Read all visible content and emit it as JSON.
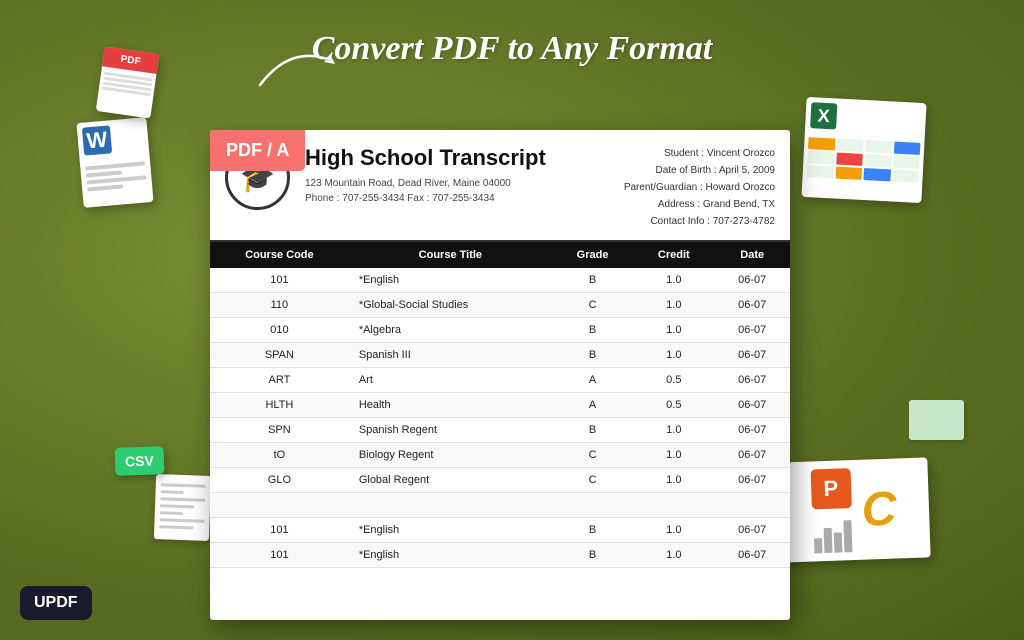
{
  "page": {
    "heading": "Convert PDF to Any Format",
    "background_color": "#6b7c2d"
  },
  "badges": {
    "pdf_a": "PDF / A",
    "csv": "CSV",
    "updf": "UPDF"
  },
  "transcript": {
    "title": "High School Transcript",
    "address_line1": "123 Mountain Road, Dead River, Maine 04000",
    "address_line2": "Phone : 707-255-3434    Fax : 707-255-3434",
    "student_label": "Student :",
    "student_name": "Vincent Orozco",
    "dob_label": "Date of Birth :",
    "dob": "April 5,  2009",
    "parent_label": "Parent/Guardian :",
    "parent": "Howard Orozco",
    "address_label": "Address :",
    "address": "Grand Bend, TX",
    "contact_label": "Contact Info :",
    "contact": "707-273-4782",
    "table": {
      "headers": [
        "Course Code",
        "Course Title",
        "Grade",
        "Credit",
        "Date"
      ],
      "rows": [
        {
          "code": "101",
          "title": "*English",
          "grade": "B",
          "credit": "1.0",
          "date": "06-07"
        },
        {
          "code": "110",
          "title": "*Global-Social Studies",
          "grade": "C",
          "credit": "1.0",
          "date": "06-07"
        },
        {
          "code": "010",
          "title": "*Algebra",
          "grade": "B",
          "credit": "1.0",
          "date": "06-07"
        },
        {
          "code": "SPAN",
          "title": "Spanish III",
          "grade": "B",
          "credit": "1.0",
          "date": "06-07"
        },
        {
          "code": "ART",
          "title": "Art",
          "grade": "A",
          "credit": "0.5",
          "date": "06-07"
        },
        {
          "code": "HLTH",
          "title": "Health",
          "grade": "A",
          "credit": "0.5",
          "date": "06-07"
        },
        {
          "code": "SPN",
          "title": "Spanish Regent",
          "grade": "B",
          "credit": "1.0",
          "date": "06-07"
        },
        {
          "code": "tO",
          "title": "Biology Regent",
          "grade": "C",
          "credit": "1.0",
          "date": "06-07"
        },
        {
          "code": "GLO",
          "title": "Global Regent",
          "grade": "C",
          "credit": "1.0",
          "date": "06-07"
        },
        {
          "code": "",
          "title": "",
          "grade": "",
          "credit": "",
          "date": ""
        },
        {
          "code": "101",
          "title": "*English",
          "grade": "B",
          "credit": "1.0",
          "date": "06-07"
        },
        {
          "code": "101",
          "title": "*English",
          "grade": "B",
          "credit": "1.0",
          "date": "06-07"
        }
      ]
    }
  }
}
